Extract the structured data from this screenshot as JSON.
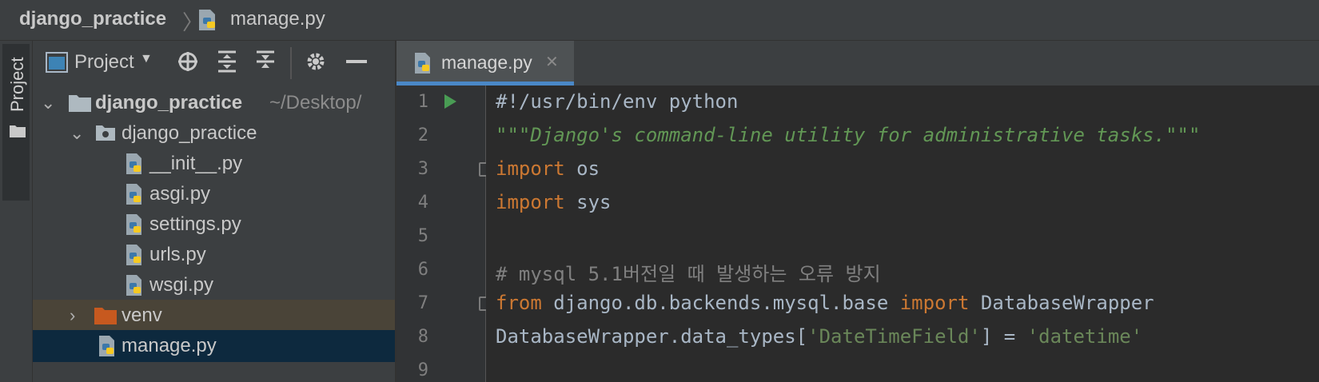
{
  "breadcrumb": {
    "project": "django_practice",
    "file": "manage.py",
    "separator": "〉"
  },
  "tool_stripe": {
    "project_tab_label": "Project"
  },
  "project_panel": {
    "title": "Project",
    "icons": [
      "locate-icon",
      "expand-all-icon",
      "collapse-all-icon",
      "gear-icon",
      "hide-icon"
    ],
    "tree": [
      {
        "label": "django_practice",
        "hint": "~/Desktop/",
        "type": "folder-root",
        "expanded": true
      },
      {
        "label": "django_practice",
        "type": "package",
        "expanded": true
      },
      {
        "label": "__init__.py",
        "type": "python-file"
      },
      {
        "label": "asgi.py",
        "type": "python-file"
      },
      {
        "label": "settings.py",
        "type": "python-file"
      },
      {
        "label": "urls.py",
        "type": "python-file"
      },
      {
        "label": "wsgi.py",
        "type": "python-file"
      },
      {
        "label": "venv",
        "type": "venv-folder",
        "expanded": false
      },
      {
        "label": "manage.py",
        "type": "python-file",
        "selected": true
      }
    ]
  },
  "editor": {
    "tab_label": "manage.py",
    "tab_close": "✕",
    "line_numbers": [
      "1",
      "2",
      "3",
      "4",
      "5",
      "6",
      "7",
      "8",
      "9"
    ],
    "lines": {
      "l1": "#!/usr/bin/env python",
      "l2": "\"\"\"Django's command-line utility for administrative tasks.\"\"\"",
      "l3_kw": "import",
      "l3_rest": " os",
      "l4_kw": "import",
      "l4_rest": " sys",
      "l6": "# mysql 5.1버전일 때 발생하는 오류 방지",
      "l7_kw1": "from",
      "l7_mid": " django.db.backends.mysql.base ",
      "l7_kw2": "import",
      "l7_rest": " DatabaseWrapper",
      "l8_a": "DatabaseWrapper.data_types[",
      "l8_str1": "'DateTimeField'",
      "l8_b": "] = ",
      "l8_str2": "'datetime'"
    }
  },
  "colors": {
    "selection": "#0d293e",
    "venv_highlight": "#4a4438",
    "tab_underline": "#4a88c7",
    "run_arrow": "#499c54"
  }
}
